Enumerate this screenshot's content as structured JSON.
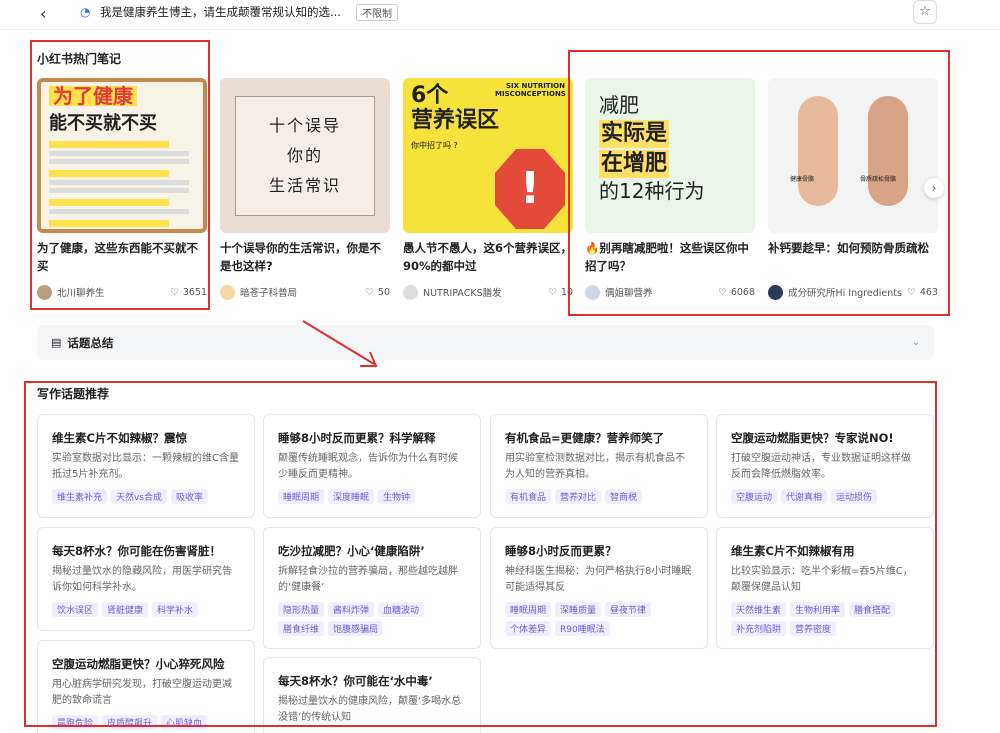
{
  "topbar": {
    "back_glyph": "‹",
    "query": "我是健康养生博主，请生成颠覆常规认知的选...",
    "badge": "不限制",
    "star_glyph": "☆"
  },
  "notes_section": {
    "title": "小红书热门笔记",
    "next_glyph": "›",
    "notes": [
      {
        "thumb_headline": "为了健康",
        "thumb_big": "能不买就不买",
        "title": "为了健康，这些东西能不买就不买",
        "author": "北川聊养生",
        "likes": "3651"
      },
      {
        "thumb_lines": [
          "十个误导",
          "你的",
          "生活常识"
        ],
        "title": "十个误导你的生活常识，你是不是也这样?",
        "author": "暗苍子科普局",
        "likes": "50"
      },
      {
        "thumb_num": "6个",
        "thumb_big": "营养误区",
        "thumb_small": "SIX NUTRITION MISCONCEPTIONS",
        "thumb_q": "你中招了吗 ?",
        "thumb_mark": "!",
        "title": "愚人节不愚人，这6个营养误区，90%的都中过",
        "author": "NUTRIPACKS膳发",
        "likes": "10"
      },
      {
        "thumb_l1": "减肥",
        "thumb_h1": "实际是",
        "thumb_h2": "在增肥",
        "thumb_l2": "的12种行为",
        "title": "🔥别再瞎减肥啦！这些误区你中招了吗？",
        "author": "偶姐聊营养",
        "likes": "6068"
      },
      {
        "thumb_label1": "健康骨骼",
        "thumb_label2": "骨质疏松骨骼",
        "title": "补钙要趁早：如何预防骨质疏松",
        "author": "成分研究所Hi Ingredients",
        "likes": "463"
      }
    ]
  },
  "summary": {
    "label": "话题总结",
    "chevron": "⌄"
  },
  "writing_section": {
    "title": "写作话题推荐",
    "cards": [
      {
        "title": "维生素C片不如辣椒？震惊",
        "desc": "实验室数据对比显示：一颗辣椒的维C含量抵过5片补充剂。",
        "tags": [
          "维生素补充",
          "天然vs合成",
          "吸收率"
        ]
      },
      {
        "title": "睡够8小时反而更累？科学解释",
        "desc": "颠覆传统睡眠观念，告诉你为什么有时候少睡反而更精神。",
        "tags": [
          "睡眠周期",
          "深度睡眠",
          "生物钟"
        ]
      },
      {
        "title": "有机食品=更健康？营养师笑了",
        "desc": "用实验室检测数据对比，揭示有机食品不为人知的营养真相。",
        "tags": [
          "有机食品",
          "营养对比",
          "智商税"
        ]
      },
      {
        "title": "空腹运动燃脂更快？专家说NO!",
        "desc": "打破空腹运动神话，专业数据证明这样做反而会降低燃脂效率。",
        "tags": [
          "空腹运动",
          "代谢真相",
          "运动损伤"
        ]
      },
      {
        "title": "每天8杯水？你可能在伤害肾脏！",
        "desc": "揭秘过量饮水的隐藏风险，用医学研究告诉你如何科学补水。",
        "tags": [
          "饮水误区",
          "肾脏健康",
          "科学补水"
        ]
      },
      {
        "title": "吃沙拉减肥？小心‘健康陷阱’",
        "desc": "拆解轻食沙拉的营养骗局，那些越吃越胖的‘健康餐’",
        "tags": [
          "隐形热量",
          "酱料炸弹",
          "血糖波动",
          "膳食纤维",
          "饱腹感骗局"
        ]
      },
      {
        "title": "睡够8小时反而更累？",
        "desc": "神经科医生揭秘：为何严格执行8小时睡眠可能适得其反",
        "tags": [
          "睡眠周期",
          "深睡质量",
          "昼夜节律",
          "个体差异",
          "R90睡眠法"
        ]
      },
      {
        "title": "维生素C片不如辣椒有用",
        "desc": "比较实验显示：吃半个彩椒=吞5片维C，颠覆保健品认知",
        "tags": [
          "天然维生素",
          "生物利用率",
          "膳食搭配",
          "补充剂陷阱",
          "营养密度"
        ]
      },
      {
        "title": "空腹运动燃脂更快？小心猝死风险",
        "desc": "用心脏病学研究发现，打破空腹运动更减肥的致命谎言",
        "tags": [
          "晨跑危险",
          "皮质醇飙升",
          "心肌缺血"
        ]
      },
      {
        "title": "每天8杯水？你可能在‘水中毒’",
        "desc": "揭秘过量饮水的健康风险，颠覆‘多喝水总没错’的传统认知",
        "tags": []
      }
    ]
  }
}
